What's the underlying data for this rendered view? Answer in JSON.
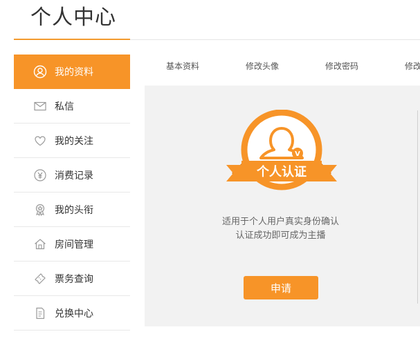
{
  "header": {
    "title": "个人中心"
  },
  "sidebar": {
    "items": [
      {
        "label": "我的资料",
        "icon": "user-icon",
        "active": true
      },
      {
        "label": "私信",
        "icon": "mail-icon"
      },
      {
        "label": "我的关注",
        "icon": "heart-icon"
      },
      {
        "label": "消费记录",
        "icon": "yen-icon"
      },
      {
        "label": "我的头衔",
        "icon": "medal-icon"
      },
      {
        "label": "房间管理",
        "icon": "house-icon"
      },
      {
        "label": "票务查询",
        "icon": "ticket-icon"
      },
      {
        "label": "兑换中心",
        "icon": "document-icon"
      }
    ]
  },
  "tabs": [
    {
      "label": "基本资料"
    },
    {
      "label": "修改头像"
    },
    {
      "label": "修改密码"
    },
    {
      "label": "修改"
    }
  ],
  "main": {
    "badge_text": "个人认证",
    "badge_mark": "V",
    "description_line1": "适用于个人用户真实身份确认",
    "description_line2": "认证成功即可成为主播",
    "apply_label": "申请"
  },
  "colors": {
    "accent": "#f79428",
    "panel_bg": "#f2f2f2",
    "text": "#333333"
  }
}
